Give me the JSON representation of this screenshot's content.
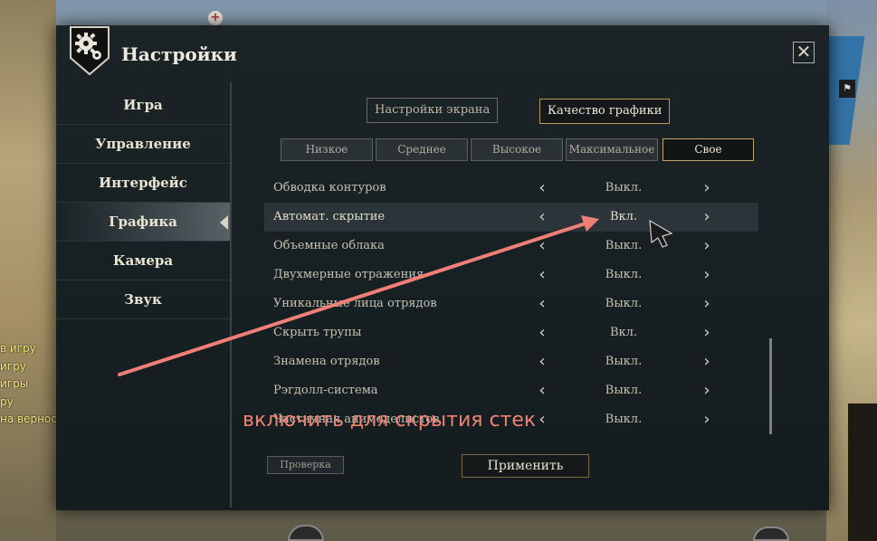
{
  "window": {
    "title": "Настройки",
    "close_label": "✕"
  },
  "sidebar": {
    "items": [
      {
        "label": "Игра",
        "active": false
      },
      {
        "label": "Управление",
        "active": false
      },
      {
        "label": "Интерфейс",
        "active": false
      },
      {
        "label": "Графика",
        "active": true
      },
      {
        "label": "Камера",
        "active": false
      },
      {
        "label": "Звук",
        "active": false
      }
    ]
  },
  "tabs": {
    "screen_settings": "Настройки экрана",
    "graphics_quality": "Качество графики",
    "active": "graphics_quality"
  },
  "presets": [
    {
      "label": "Низкое",
      "active": false
    },
    {
      "label": "Среднее",
      "active": false
    },
    {
      "label": "Высокое",
      "active": false
    },
    {
      "label": "Максимальное",
      "active": false
    },
    {
      "label": "Свое",
      "active": true
    }
  ],
  "settings": [
    {
      "label": "Обводка контуров",
      "value": "Выкл.",
      "highlighted": false
    },
    {
      "label": "Автомат. скрытие",
      "value": "Вкл.",
      "highlighted": true
    },
    {
      "label": "Объемные облака",
      "value": "Выкл.",
      "highlighted": false
    },
    {
      "label": "Двухмерные отражения",
      "value": "Выкл.",
      "highlighted": false
    },
    {
      "label": "Уникальные лица отрядов",
      "value": "Выкл.",
      "highlighted": false
    },
    {
      "label": "Скрыть трупы",
      "value": "Вкл.",
      "highlighted": false
    },
    {
      "label": "Знамена отрядов",
      "value": "Выкл.",
      "highlighted": false
    },
    {
      "label": "Рэгдолл-система",
      "value": "Выкл.",
      "highlighted": false
    },
    {
      "label": "Частичная анимоделистов",
      "value": "Выкл.",
      "highlighted": false
    }
  ],
  "footer": {
    "check_label": "Проверка",
    "apply_label": "Применить"
  },
  "annotation": {
    "text": "включить для скрытия стек",
    "color": "#ee8272"
  },
  "chat": {
    "lines": [
      "в игру",
      "игру",
      "игры",
      "ру",
      "на вернос"
    ],
    "color": "#f1e879"
  },
  "icons": {
    "logo": "gear-shield-icon",
    "close": "close-icon",
    "arrow_left": "chevron-left-icon",
    "arrow_right": "chevron-right-icon",
    "cursor": "cursor-arrow-icon"
  }
}
